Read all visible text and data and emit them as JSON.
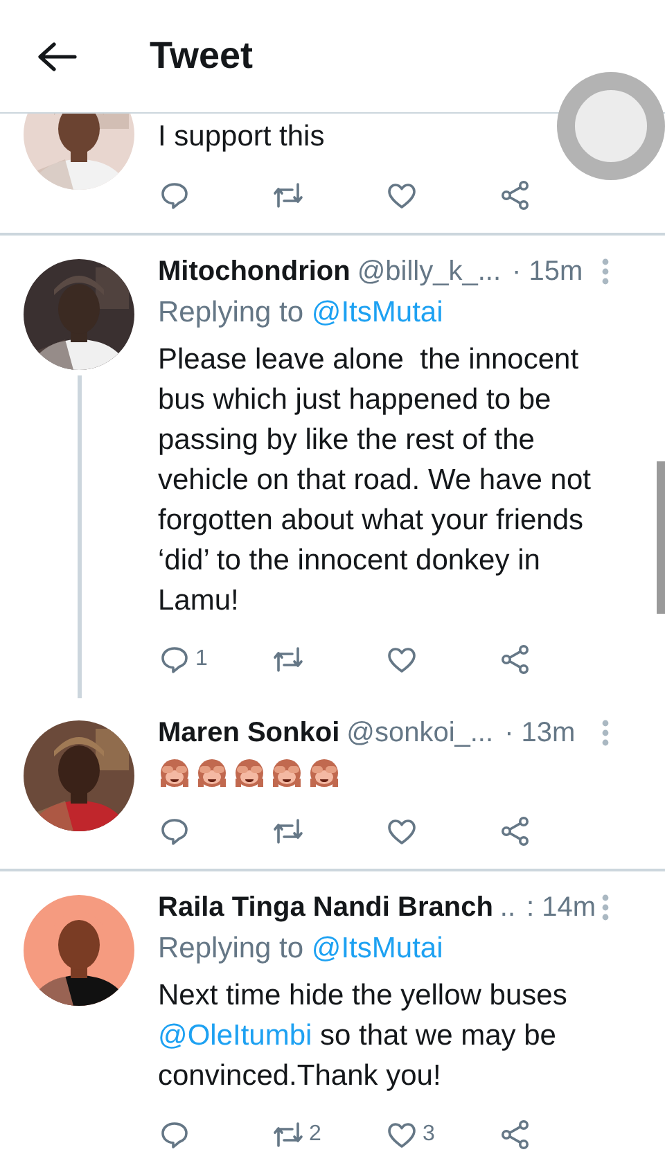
{
  "header": {
    "title": "Tweet"
  },
  "tweets": [
    {
      "avatar": {
        "kind": "picture"
      },
      "connected": false,
      "body": [
        {
          "kind": "text",
          "text": "I support this"
        }
      ],
      "actions": [
        {
          "kind": "reply"
        },
        {
          "kind": "retweet"
        },
        {
          "kind": "like"
        },
        {
          "kind": "share"
        }
      ]
    },
    {
      "avatar": {
        "kind": "picture"
      },
      "connected": true,
      "name": "Mitochondrion",
      "handle": "@billy_k_...",
      "time": "· 15m",
      "replying_to": {
        "label": "Replying to",
        "handle": "@ItsMutai"
      },
      "body": [
        {
          "kind": "text",
          "text": "Please leave alone  the innocent bus which just happened to be passing by like the rest of the vehicle on that road. We have not forgotten about what your friends ‘did’ to the innocent donkey in Lamu!"
        }
      ],
      "actions": [
        {
          "kind": "reply",
          "count": "1"
        },
        {
          "kind": "retweet"
        },
        {
          "kind": "like"
        },
        {
          "kind": "share"
        }
      ]
    },
    {
      "avatar": {
        "kind": "picture"
      },
      "connected": false,
      "name": "Maren Sonkoi",
      "handle": "@sonkoi_...",
      "time": "· 13m",
      "emoji": [
        {
          "kind": "see-no-evil"
        },
        {
          "kind": "see-no-evil"
        },
        {
          "kind": "see-no-evil"
        },
        {
          "kind": "see-no-evil"
        },
        {
          "kind": "see-no-evil"
        }
      ],
      "actions": [
        {
          "kind": "reply"
        },
        {
          "kind": "retweet"
        },
        {
          "kind": "like"
        },
        {
          "kind": "share"
        }
      ]
    },
    {
      "avatar": {
        "kind": "picture"
      },
      "name": "Raila Tinga Nandi Branch",
      "handle": "..",
      "time": ": 14m",
      "replying_to": {
        "label": "Replying to",
        "handle": "@ItsMutai"
      },
      "body": [
        {
          "kind": "text",
          "text": "Next time hide the yellow buses "
        },
        {
          "kind": "link",
          "text": "@OleItumbi"
        },
        {
          "kind": "text",
          "text": " so that we may be convinced.Thank you!"
        }
      ],
      "actions": [
        {
          "kind": "reply"
        },
        {
          "kind": "retweet",
          "count": "2"
        },
        {
          "kind": "like",
          "count": "3"
        },
        {
          "kind": "share"
        }
      ]
    }
  ]
}
